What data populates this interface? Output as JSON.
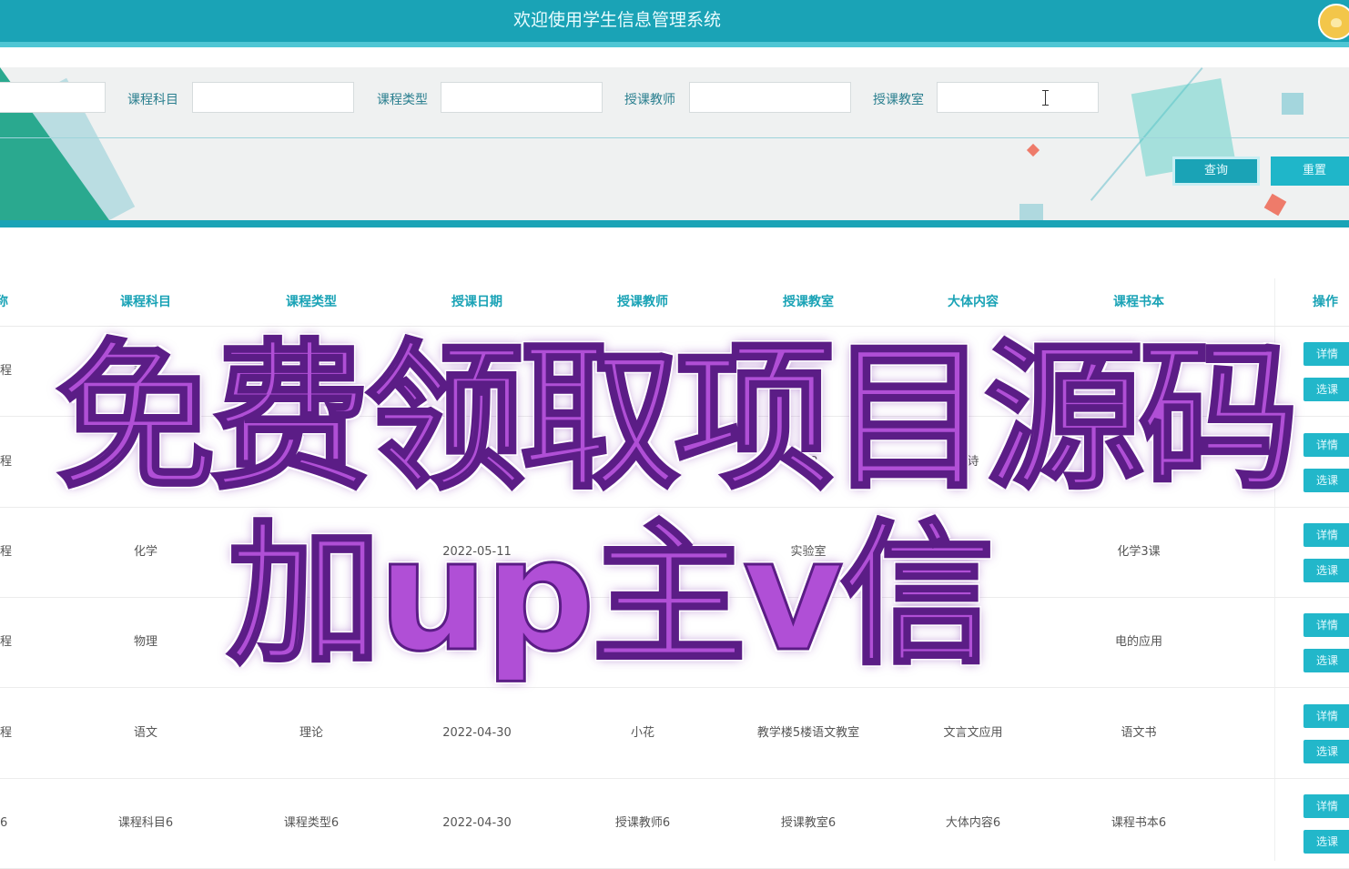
{
  "header": {
    "title": "欢迎使用学生信息管理系统",
    "avatar_icon": "user-avatar-icon"
  },
  "search": {
    "fields": [
      {
        "label": "课程科目",
        "value": ""
      },
      {
        "label": "课程类型",
        "value": ""
      },
      {
        "label": "授课教师",
        "value": ""
      },
      {
        "label": "授课教室",
        "value": ""
      }
    ],
    "query_label": "查询",
    "reset_label": "重置"
  },
  "table": {
    "columns": [
      "称",
      "课程科目",
      "课程类型",
      "授课日期",
      "授课教师",
      "授课教室",
      "大体内容",
      "课程书本",
      "操作"
    ],
    "rows": [
      {
        "c0": "程",
        "subject": "数学",
        "type": "",
        "date": "",
        "teacher": "",
        "room": "",
        "content": "",
        "book": ""
      },
      {
        "c0": "程",
        "subject": "",
        "type": "论",
        "date": "",
        "teacher": "",
        "room": "楼2",
        "content": "诗",
        "book": ""
      },
      {
        "c0": "程",
        "subject": "化学",
        "type": "",
        "date": "2022-05-11",
        "teacher": "",
        "room": "实验室",
        "content": "",
        "book": "化学3课"
      },
      {
        "c0": "程",
        "subject": "物理",
        "type": "",
        "date": "",
        "teacher": "",
        "room": "",
        "content": "",
        "book": "电的应用"
      },
      {
        "c0": "程",
        "subject": "语文",
        "type": "理论",
        "date": "2022-04-30",
        "teacher": "小花",
        "room": "教学楼5楼语文教室",
        "content": "文言文应用",
        "book": "语文书"
      },
      {
        "c0": "6",
        "subject": "课程科目6",
        "type": "课程类型6",
        "date": "2022-04-30",
        "teacher": "授课教师6",
        "room": "授课教室6",
        "content": "大体内容6",
        "book": "课程书本6"
      }
    ],
    "detail_label": "详情",
    "select_label": "选课"
  },
  "watermark": {
    "line1": "免费领取项目源码",
    "line2": "加up主v信"
  },
  "colors": {
    "primary": "#1aa3b6",
    "header_text": "#1aa3b6",
    "watermark": "#b04fd6"
  }
}
